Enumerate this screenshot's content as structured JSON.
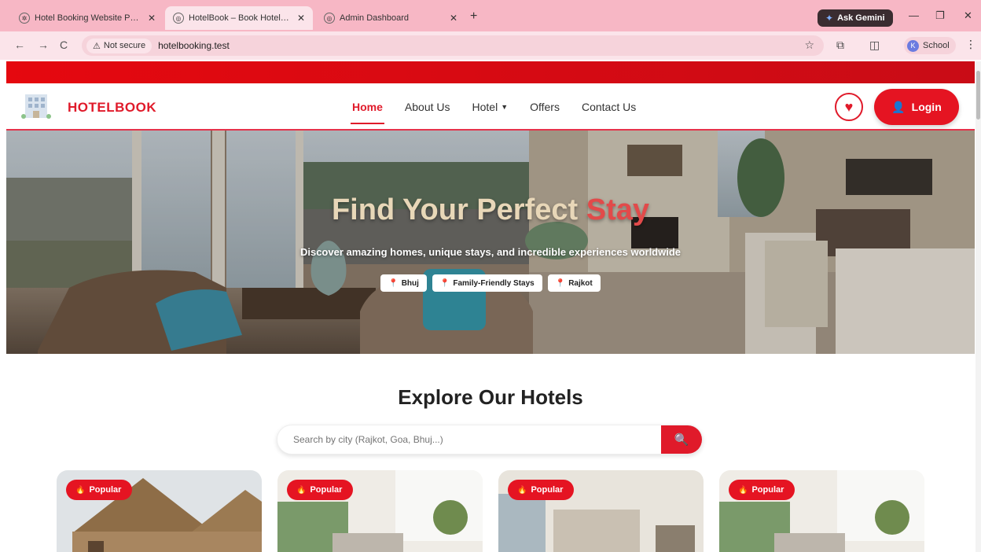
{
  "browser": {
    "tabs": [
      {
        "title": "Hotel Booking Website Project",
        "active": false
      },
      {
        "title": "HotelBook – Book Hotels Online",
        "active": true
      },
      {
        "title": "Admin Dashboard",
        "active": false
      }
    ],
    "new_tab": "+",
    "gemini_label": "Ask Gemini",
    "not_secure_label": "Not secure",
    "url": "hotelbooking.test",
    "profile_initial": "K",
    "profile_name": "School"
  },
  "nav": {
    "brand": "HOTELBOOK",
    "links": [
      {
        "label": "Home",
        "active": true
      },
      {
        "label": "About Us",
        "active": false
      },
      {
        "label": "Hotel",
        "active": false,
        "dropdown": true
      },
      {
        "label": "Offers",
        "active": false
      },
      {
        "label": "Contact Us",
        "active": false
      }
    ],
    "login_label": "Login"
  },
  "hero": {
    "title_main": "Find Your Perfect ",
    "title_accent": "Stay",
    "subtitle": "Discover amazing homes, unique stays, and incredible experiences worldwide",
    "chips": [
      "Bhuj",
      "Family-Friendly Stays",
      "Rajkot"
    ]
  },
  "explore": {
    "title": "Explore Our Hotels",
    "search_placeholder": "Search by city (Rajkot, Goa, Bhuj...)"
  },
  "cards": [
    {
      "badge": "Popular"
    },
    {
      "badge": "Popular"
    },
    {
      "badge": "Popular"
    },
    {
      "badge": "Popular"
    }
  ],
  "colors": {
    "brand_red": "#e01a2a",
    "tabstrip_pink": "#f7b7c5"
  }
}
